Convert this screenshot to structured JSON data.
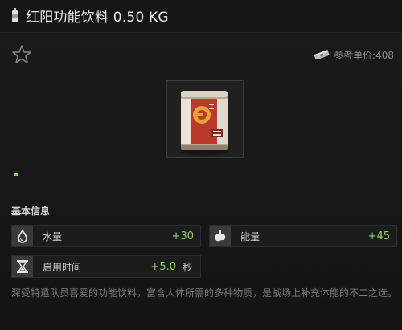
{
  "item": {
    "title": "红阳功能饮料 0.50 KG",
    "price": "参考单价:408",
    "description": "深受特遣队员喜爱的功能饮料，富含人体所需的多种物质，是战场上补充体能的不二之选。"
  },
  "section": {
    "basic_info": "基本信息"
  },
  "stats": [
    {
      "label": "水量",
      "value": "+30",
      "icon": "water-drop-icon"
    },
    {
      "label": "能量",
      "value": "+45",
      "icon": "stomach-icon"
    },
    {
      "label": "启用时间",
      "value": "+5.0",
      "unit": "秒",
      "icon": "hourglass-icon"
    }
  ],
  "colors": {
    "value_green": "#8ad36a",
    "background": "#131313"
  }
}
